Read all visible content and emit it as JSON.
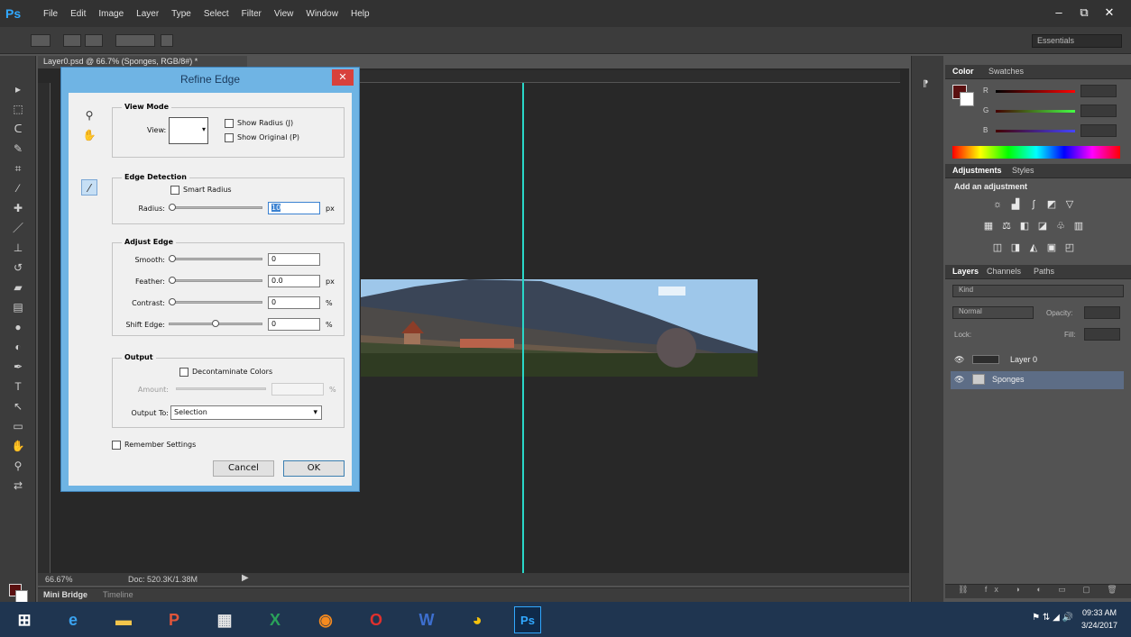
{
  "menubar": {
    "logo": "Ps",
    "items": [
      "File",
      "Edit",
      "Image",
      "Layer",
      "Type",
      "Select",
      "Filter",
      "View",
      "Window",
      "Help"
    ],
    "window_controls": [
      "–",
      "⧉",
      "✕"
    ]
  },
  "options_bar": {
    "workspace": "Essentials"
  },
  "document": {
    "tab_title": "Layer0.psd @ 66.7% (Sponges, RGB/8#) *",
    "zoom": "66.67%",
    "doc_size": "Doc: 520.3K/1.38M"
  },
  "mini_bridge": {
    "tabs": [
      "Mini Bridge",
      "Timeline"
    ]
  },
  "dialog": {
    "title": "Refine Edge",
    "close": "✕",
    "view_mode": {
      "title": "View Mode",
      "view_label": "View:",
      "show_radius": "Show Radius (J)",
      "show_original": "Show Original (P)"
    },
    "edge_detection": {
      "title": "Edge Detection",
      "smart_radius": "Smart Radius",
      "radius_label": "Radius:",
      "radius_value": "10",
      "radius_unit": "px"
    },
    "adjust_edge": {
      "title": "Adjust Edge",
      "smooth_label": "Smooth:",
      "smooth_value": "0",
      "feather_label": "Feather:",
      "feather_value": "0.0",
      "feather_unit": "px",
      "contrast_label": "Contrast:",
      "contrast_value": "0",
      "contrast_unit": "%",
      "shift_label": "Shift Edge:",
      "shift_value": "0",
      "shift_unit": "%"
    },
    "output": {
      "title": "Output",
      "decontaminate": "Decontaminate Colors",
      "amount_label": "Amount:",
      "amount_unit": "%",
      "output_to_label": "Output To:",
      "output_to_value": "Selection"
    },
    "remember": "Remember Settings",
    "cancel": "Cancel",
    "ok": "OK"
  },
  "panels": {
    "color_tabs": [
      "Color",
      "Swatches"
    ],
    "channels": [
      "R",
      "G",
      "B"
    ],
    "adjust_tabs": [
      "Adjustments",
      "Styles"
    ],
    "adjust_title": "Add an adjustment",
    "layers_tabs": [
      "Layers",
      "Channels",
      "Paths"
    ],
    "filter_kind": "Kind",
    "blend_mode": "Normal",
    "opacity_label": "Opacity:",
    "lock_label": "Lock:",
    "fill_label": "Fill:",
    "layers": [
      "Layer 0",
      "Sponges"
    ]
  },
  "taskbar": {
    "time": "09:33 AM",
    "date": "3/24/2017"
  },
  "colors": {
    "accent": "#31a8ff",
    "guide": "#29d7c8",
    "foreground": "#5a1010",
    "dialog_frame": "#6fb4e4",
    "taskbar": "#1f3550"
  }
}
